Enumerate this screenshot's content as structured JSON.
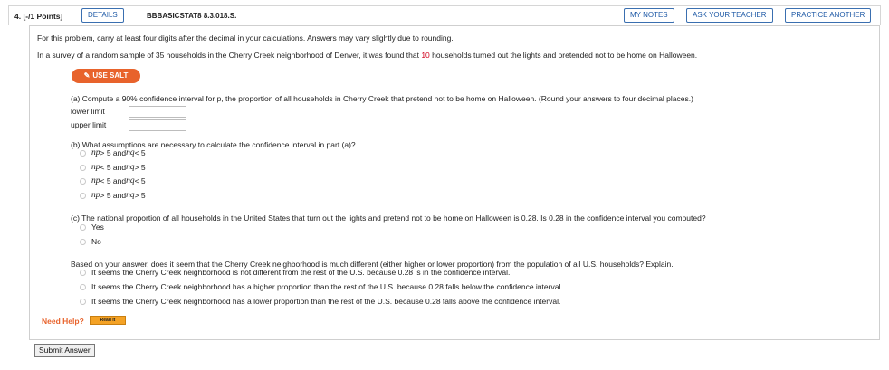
{
  "header": {
    "points": "4. [-/1 Points]",
    "details_label": "DETAILS",
    "code": "BBBASICSTAT8 8.3.018.S.",
    "my_notes_label": "MY NOTES",
    "ask_teacher_label": "ASK YOUR TEACHER",
    "practice_label": "PRACTICE ANOTHER"
  },
  "intro": {
    "instruction": "For this problem, carry at least four digits after the decimal in your calculations. Answers may vary slightly due to rounding.",
    "problem_before": "In a survey of a random sample of 35 households in the Cherry Creek neighborhood of Denver, it was found that ",
    "problem_value": "10",
    "problem_after": " households turned out the lights and pretended not to be home on Halloween."
  },
  "salt_button": {
    "label": "USE SALT",
    "icon": "pencil-icon",
    "color": "#e8632c"
  },
  "part_a": {
    "question": "(a) Compute a 90% confidence interval for p, the proportion of all households in Cherry Creek that pretend not to be home on Halloween. (Round your answers to four decimal places.)",
    "lower_label": "lower limit",
    "upper_label": "upper limit",
    "lower_value": "",
    "upper_value": ""
  },
  "part_b": {
    "question": "(b) What assumptions are necessary to calculate the confidence interval in part (a)?",
    "options": [
      [
        "np",
        " > 5 and ",
        "nq",
        " < 5"
      ],
      [
        "np",
        " < 5 and ",
        "nq",
        " > 5"
      ],
      [
        "np",
        " < 5 and ",
        "nq",
        " < 5"
      ],
      [
        "np",
        " > 5 and ",
        "nq",
        " > 5"
      ]
    ]
  },
  "part_c": {
    "question": "(c) The national proportion of all households in the United States that turn out the lights and pretend not to be home on Halloween is 0.28. Is 0.28 in the confidence interval you computed?",
    "options": [
      "Yes",
      "No"
    ]
  },
  "part_d": {
    "question": "Based on your answer, does it seem that the Cherry Creek neighborhood is much different (either higher or lower proportion) from the population of all U.S. households? Explain.",
    "options": [
      "It seems the Cherry Creek neighborhood is not different from the rest of the U.S. because 0.28 is in the confidence interval.",
      "It seems the Cherry Creek neighborhood has a higher proportion than the rest of the U.S. because 0.28 falls below the confidence interval.",
      "It seems the Cherry Creek neighborhood has a lower proportion than the rest of the U.S. because 0.28 falls above the confidence interval."
    ]
  },
  "help": {
    "label": "Need Help?",
    "read_it_label": "Read It"
  },
  "submit_label": "Submit Answer",
  "colors": {
    "accent_blue": "#1f5aa6",
    "salt_orange": "#e8632c",
    "highlight_red": "#d0011b"
  }
}
